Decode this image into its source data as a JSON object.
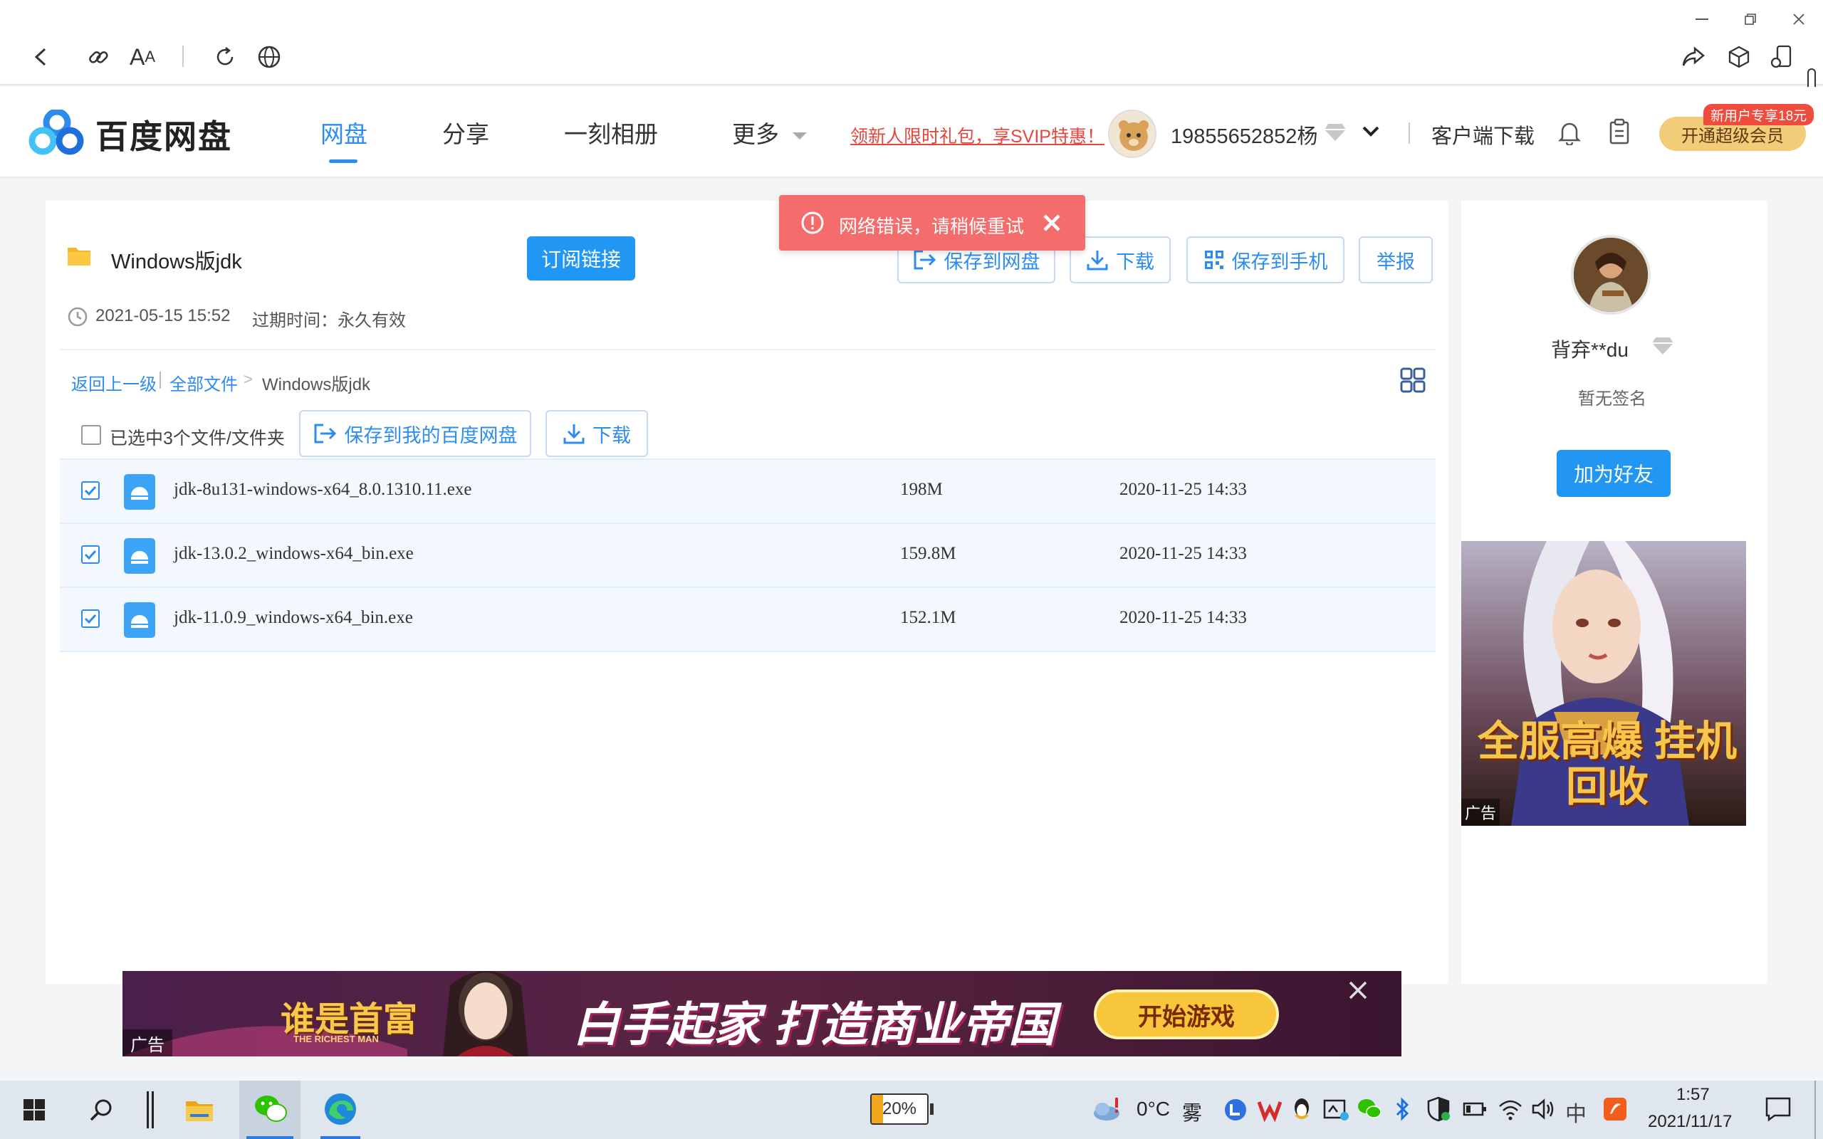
{
  "site": {
    "logo_text": "百度网盘",
    "nav": [
      "网盘",
      "分享",
      "一刻相册",
      "更多"
    ],
    "promo_link": "领新人限时礼包，享SVIP特惠！",
    "username": "19855652852杨",
    "client_download": "客户端下载",
    "vip_badge": "新用户专享18元",
    "vip_button": "开通超级会员"
  },
  "toast": {
    "message": "网络错误，请稍候重试"
  },
  "share": {
    "title": "Windows版jdk",
    "subscribe": "订阅链接",
    "created": "2021-05-15 15:52",
    "expire": "过期时间：永久有效",
    "actions": {
      "save_to_pan": "保存到网盘",
      "download": "下载",
      "save_to_phone": "保存到手机",
      "report": "举报"
    }
  },
  "breadcrumb": {
    "back": "返回上一级",
    "all": "全部文件",
    "sep": ">",
    "current": "Windows版jdk"
  },
  "toolbar": {
    "selected": "已选中3个文件/文件夹",
    "save_my": "保存到我的百度网盘",
    "download": "下载"
  },
  "files": [
    {
      "name": "jdk-8u131-windows-x64_8.0.1310.11.exe",
      "size": "198M",
      "date": "2020-11-25 14:33"
    },
    {
      "name": "jdk-13.0.2_windows-x64_bin.exe",
      "size": "159.8M",
      "date": "2020-11-25 14:33"
    },
    {
      "name": "jdk-11.0.9_windows-x64_bin.exe",
      "size": "152.1M",
      "date": "2020-11-25 14:33"
    }
  ],
  "sidebar": {
    "owner": "背弃**du",
    "signature": "暂无签名",
    "add_friend": "加为好友"
  },
  "ads": {
    "side_text": "全服高爆 挂机回收",
    "ad_label": "广告",
    "banner_brand": "谁是首富",
    "banner_brand_en": "THE RICHEST MAN",
    "banner_slogan": "白手起家 打造商业帝国",
    "banner_cta": "开始游戏"
  },
  "taskbar": {
    "battery": "20%",
    "temp": "0°C",
    "weather": "雾",
    "ime": "中",
    "time": "1:57",
    "date": "2021/11/17"
  },
  "colors": {
    "accent": "#2c8cf0",
    "toast": "#f46c6c",
    "promo": "#e8453c",
    "vip_bg": "#f3cc7a"
  }
}
